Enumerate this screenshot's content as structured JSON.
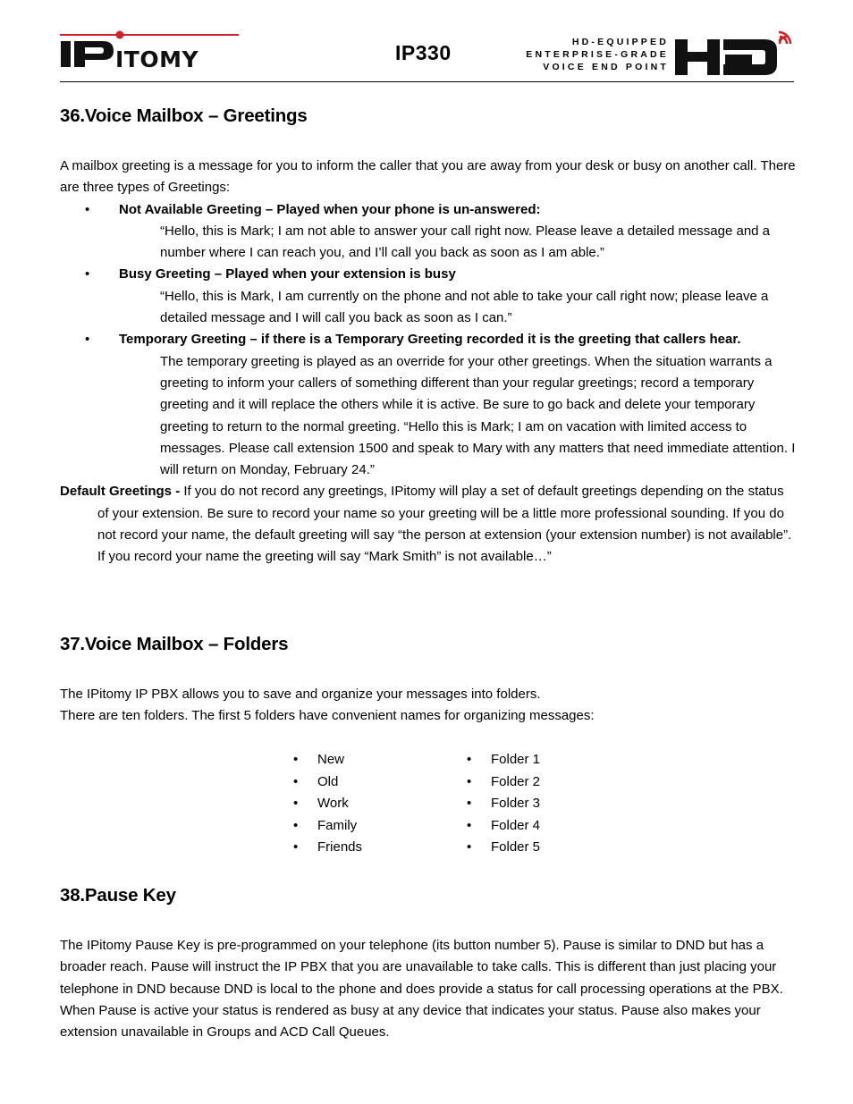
{
  "header": {
    "brand": "IPitomy",
    "model": "IP330",
    "tagline": [
      "HD-EQUIPPED",
      "ENTERPRISE-GRADE",
      "VOICE END POINT"
    ],
    "hd_badge": "HD",
    "brand_red": "#d0202a"
  },
  "sections": {
    "greetings": {
      "title": "36.Voice Mailbox – Greetings",
      "intro": "A mailbox greeting is a message for you to inform the caller that you are away from your desk or busy on another call. There are three types of Greetings:",
      "items": [
        {
          "label": "Not Available Greeting – Played when your phone is un-answered:",
          "text": "“Hello, this is Mark; I am not able to answer your call right now. Please leave a detailed message and a number where I can reach you, and I’ll call you back as soon as I am able.”"
        },
        {
          "label": "Busy Greeting – Played when your extension is busy",
          "text": "“Hello, this is Mark, I am currently on the phone and not able to take your call right now; please leave a detailed message and I will call you back as soon as I can.”"
        },
        {
          "label": "Temporary Greeting – if there is a Temporary Greeting recorded it is the greeting that callers hear.",
          "text": "The temporary greeting is played as an override for your other greetings. When the situation warrants a greeting to inform your callers of something different than your regular greetings; record a temporary greeting and it will replace the others while it is active. Be sure to go back and delete your temporary greeting to return to the normal greeting. “Hello this is Mark; I am on vacation with limited access to messages. Please call extension 1500 and speak to Mary with any matters that need immediate attention. I will return on Monday, February 24.”"
        }
      ],
      "default_label": "Default Greetings -",
      "default_text": " If you do not record any greetings, IPitomy will play a set of default greetings depending on the status of your extension. Be sure to record your name so your greeting will be a little more professional sounding. If you do not record your name, the default greeting will say “the person at extension (your extension number) is not available”. If you record your name the greeting will say “Mark Smith” is not available…”"
    },
    "folders": {
      "title": "37.Voice Mailbox – Folders",
      "line1": "The IPitomy IP PBX allows you to save and organize your messages into folders.",
      "line2": "There are ten folders. The first 5 folders have convenient names for organizing messages:",
      "named_folders": [
        "New",
        "Old",
        "Work",
        "Family",
        "Friends"
      ],
      "numbered_folders": [
        "Folder 1",
        "Folder 2",
        "Folder 3",
        "Folder 4",
        "Folder 5"
      ]
    },
    "pause": {
      "title": "38.Pause Key",
      "text": "The IPitomy Pause Key is pre-programmed on your telephone (its button number 5). Pause is similar to DND but has a broader reach. Pause will instruct the IP PBX that you are unavailable to take calls. This is different than just placing your telephone in DND because DND is local to the phone and does provide a status for call processing operations at the PBX. When Pause is active your status is rendered as busy at any device that indicates your status. Pause also makes your extension unavailable in Groups and ACD Call Queues."
    }
  },
  "bullet_glyph": "•"
}
